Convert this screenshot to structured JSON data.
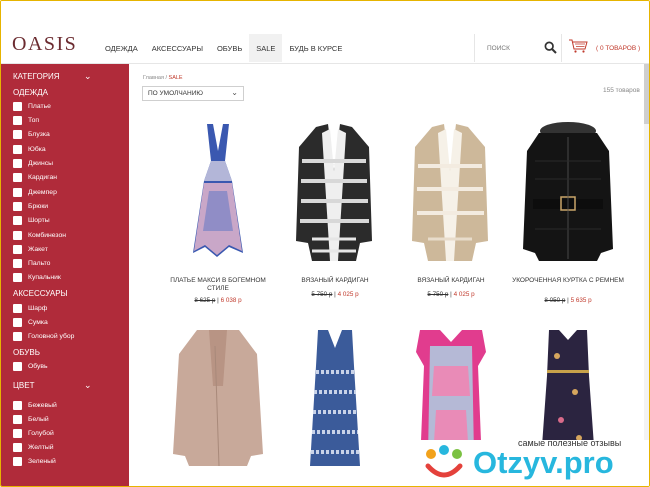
{
  "header": {
    "logo": "OASIS",
    "nav": [
      "ОДЕЖДА",
      "АКСЕССУАРЫ",
      "ОБУВЬ",
      "SALE",
      "БУДЬ В КУРСЕ"
    ],
    "search_placeholder": "ПОИСК",
    "cart_text": "( 0 ТОВАРОВ )"
  },
  "sidebar": {
    "category_label": "КАТЕГОРИЯ",
    "clothing_label": "ОДЕЖДА",
    "clothing_items": [
      "Платье",
      "Топ",
      "Блузка",
      "Юбка",
      "Джинсы",
      "Кардиган",
      "Джемпер",
      "Брюки",
      "Шорты",
      "Комбинезон",
      "Жакет",
      "Пальто",
      "Купальник"
    ],
    "accessories_label": "АКСЕССУАРЫ",
    "accessories_items": [
      "Шарф",
      "Сумка",
      "Головной убор"
    ],
    "shoes_label": "ОБУВЬ",
    "shoes_items": [
      "Обувь"
    ],
    "color_label": "ЦВЕТ",
    "color_items": [
      "Бежевый",
      "Белый",
      "Голубой",
      "Желтый",
      "Зеленый"
    ]
  },
  "main": {
    "breadcrumb_home": "Главная",
    "breadcrumb_sep": "/",
    "breadcrumb_current": "SALE",
    "sort_value": "ПО УМОЛЧАНИЮ",
    "count": "155 товаров"
  },
  "products": [
    {
      "name": "ПЛАТЬЕ МАКСИ В БОГЕМНОМ СТИЛЕ",
      "old_price": "8 625 р",
      "new_price": "6 038 р"
    },
    {
      "name": "ВЯЗАНЫЙ КАРДИГАН",
      "old_price": "5 750 р",
      "new_price": "4 025 р"
    },
    {
      "name": "ВЯЗАНЫЙ КАРДИГАН",
      "old_price": "5 750 р",
      "new_price": "4 025 р"
    },
    {
      "name": "УКОРОЧЕННАЯ КУРТКА С РЕМНЕМ",
      "old_price": "8 050 р",
      "new_price": "5 635 р"
    },
    {
      "name": "",
      "old_price": "",
      "new_price": ""
    },
    {
      "name": "",
      "old_price": "",
      "new_price": ""
    },
    {
      "name": "",
      "old_price": "",
      "new_price": ""
    },
    {
      "name": "",
      "old_price": "",
      "new_price": ""
    }
  ],
  "watermark": {
    "tagline": "самые полезные отзывы",
    "word": "Otzyv.pro"
  },
  "colors": {
    "sidebar": "#b02b3a",
    "accent": "#c0392b",
    "logo": "#6b2b30",
    "watermark": "#27b7de"
  }
}
